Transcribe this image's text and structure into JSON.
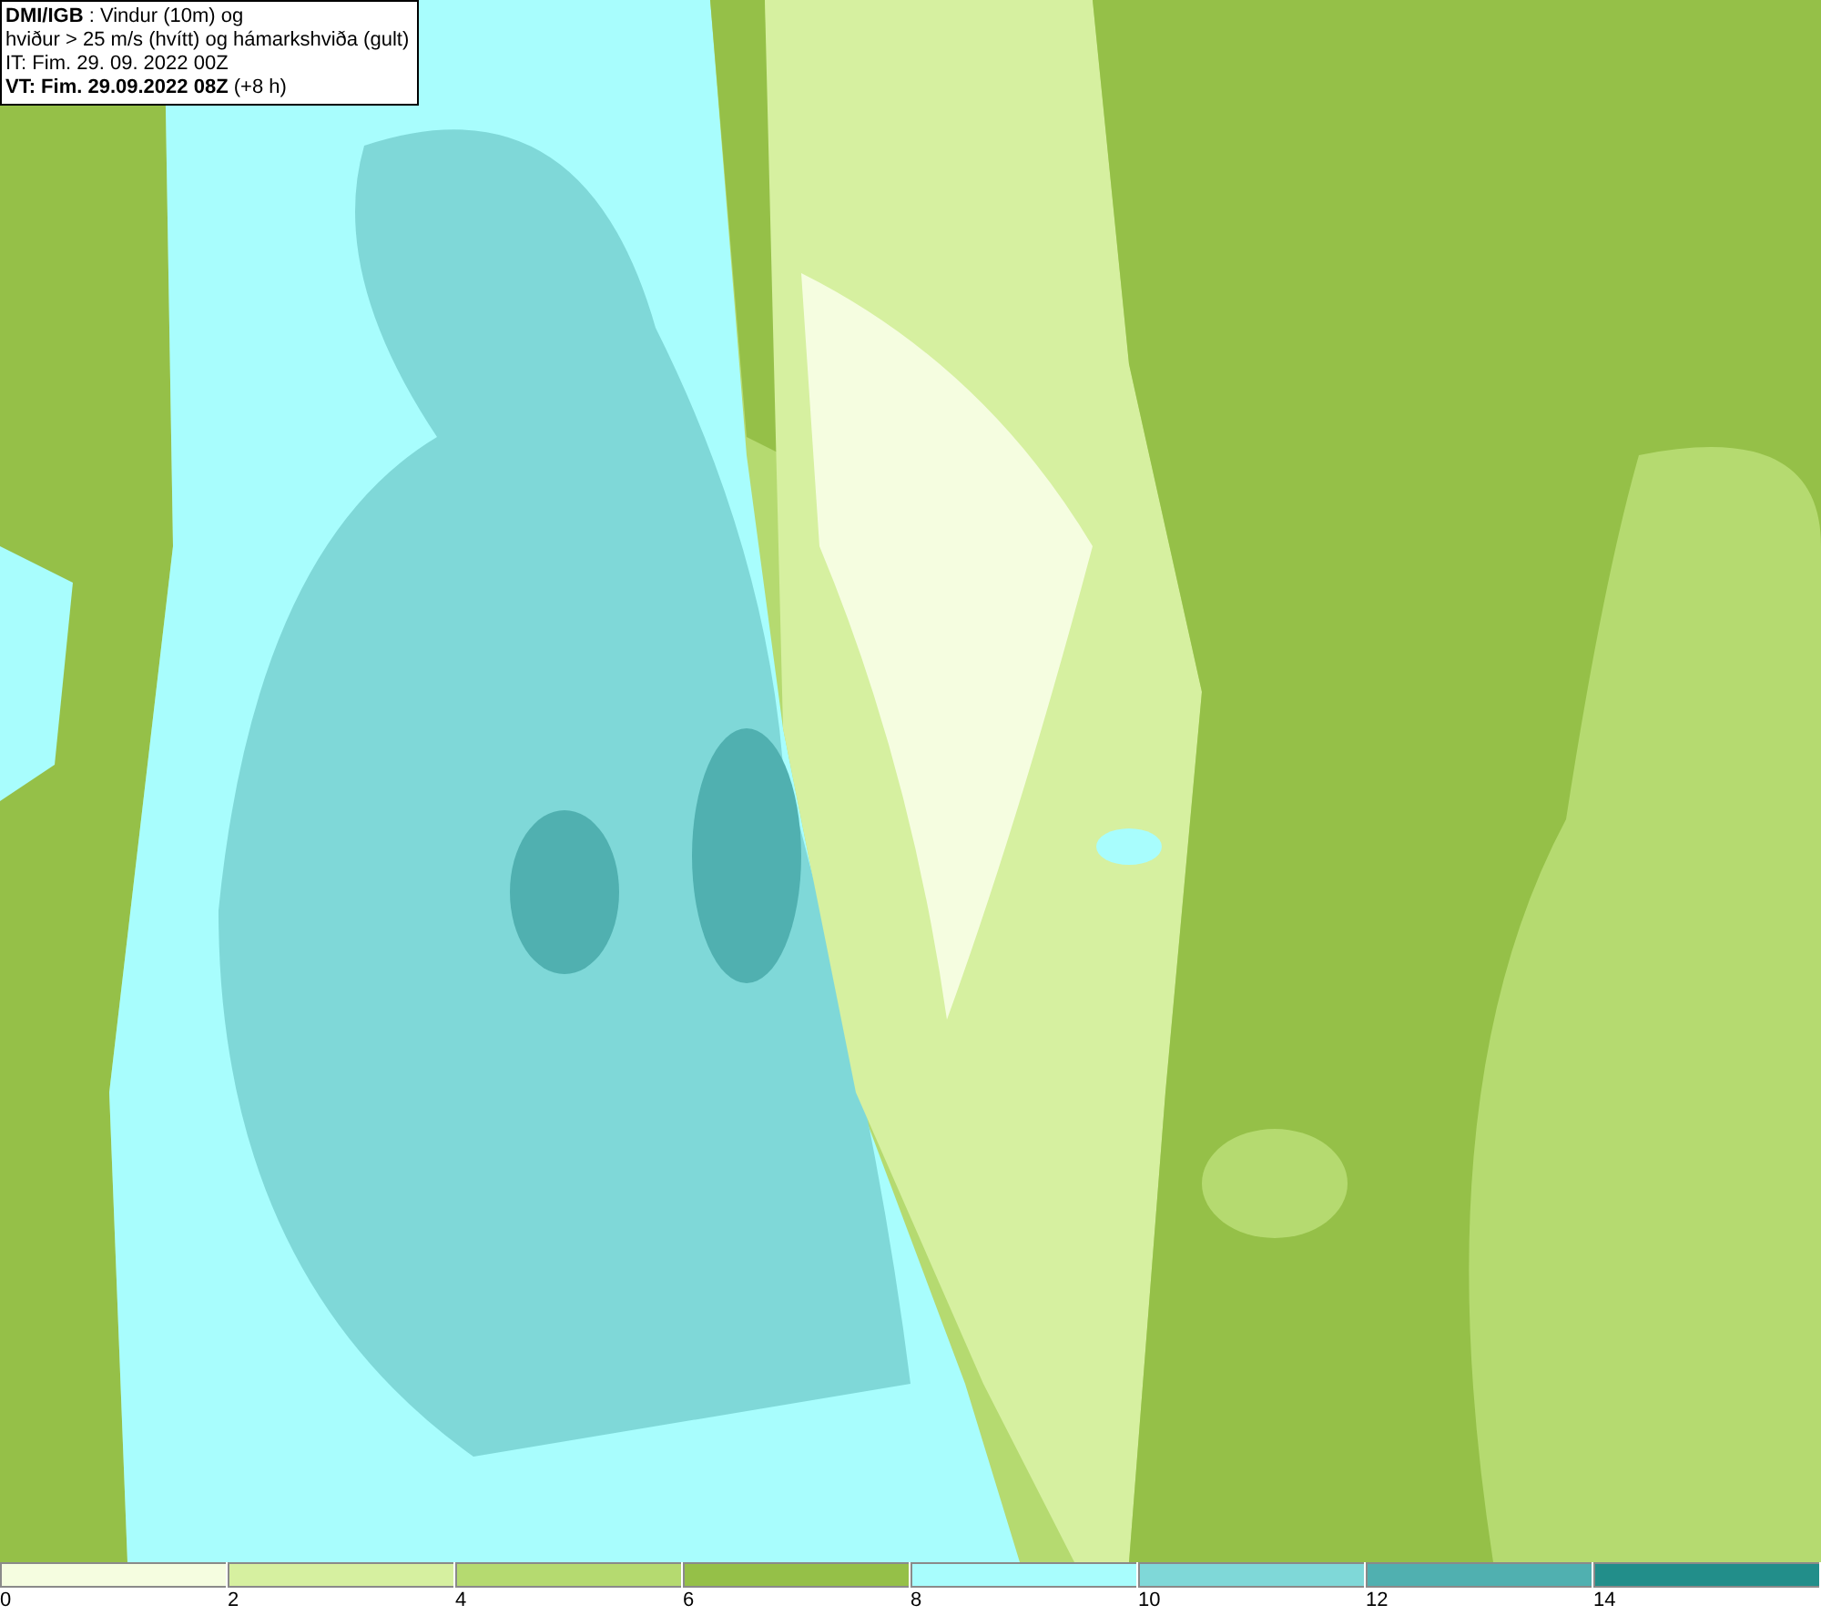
{
  "info_box": {
    "lines": [
      "**DMI/IGB** : Vindur (10m) og",
      "hviður > 25 m/s (hvítt) og hámarkshviða (gult)",
      "IT: Fim. 29. 09. 2022 00Z",
      "**VT: Fim. 29.09.2022 08Z** (+8 h)"
    ]
  },
  "legend": [
    {
      "color": "#f5fde0",
      "label": "0"
    },
    {
      "color": "#d6f0a0",
      "label": "2"
    },
    {
      "color": "#b5da70",
      "label": "4"
    },
    {
      "color": "#95c048",
      "label": "6"
    },
    {
      "color": "#a8fdfd",
      "label": "8"
    },
    {
      "color": "#7fd8d8",
      "label": "10"
    },
    {
      "color": "#50b0b0",
      "label": "12"
    },
    {
      "color": "#228e8a",
      "label": "14"
    }
  ]
}
